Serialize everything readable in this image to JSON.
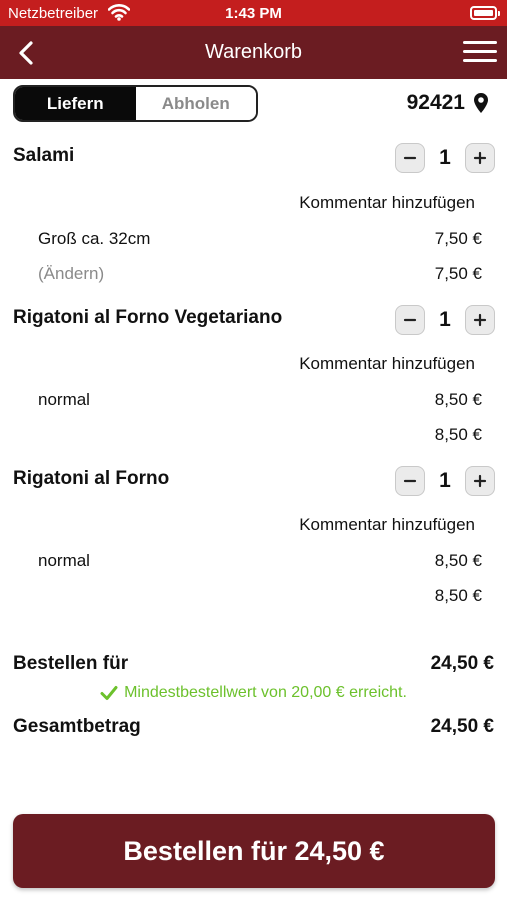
{
  "status_bar": {
    "carrier": "Netzbetreiber",
    "time": "1:43 PM"
  },
  "header": {
    "title": "Warenkorb"
  },
  "delivery_toggle": {
    "deliver_label": "Liefern",
    "pickup_label": "Abholen",
    "selected": "Liefern"
  },
  "postal_code": "92421",
  "items": [
    {
      "name": "Salami",
      "quantity": "1",
      "comment_link": "Kommentar hinzufügen",
      "option_label": "Groß ca. 32cm",
      "option_price": "7,50 €",
      "change_label": "(Ändern)",
      "total_price": "7,50 €"
    },
    {
      "name": "Rigatoni al Forno Vegetariano",
      "quantity": "1",
      "comment_link": "Kommentar hinzufügen",
      "option_label": "normal",
      "option_price": "8,50 €",
      "total_price": "8,50 €"
    },
    {
      "name": "Rigatoni al Forno",
      "quantity": "1",
      "comment_link": "Kommentar hinzufügen",
      "option_label": "normal",
      "option_price": "8,50 €",
      "total_price": "8,50 €"
    }
  ],
  "summary": {
    "order_for_label": "Bestellen für",
    "order_for_value": "24,50 €",
    "min_order_message": "Mindestbestellwert von 20,00 € erreicht.",
    "total_label": "Gesamtbetrag",
    "total_value": "24,50 €"
  },
  "order_button": {
    "label": "Bestellen für 24,50 €"
  },
  "colors": {
    "status_bar": "#c41e1e",
    "brand": "#6b1c22",
    "success": "#6cc12c",
    "muted": "#8a8a8a"
  },
  "icons": [
    "wifi-icon",
    "battery-icon",
    "back-arrow-icon",
    "hamburger-menu-icon",
    "location-pin-icon",
    "minus-icon",
    "plus-icon",
    "checkmark-icon"
  ]
}
